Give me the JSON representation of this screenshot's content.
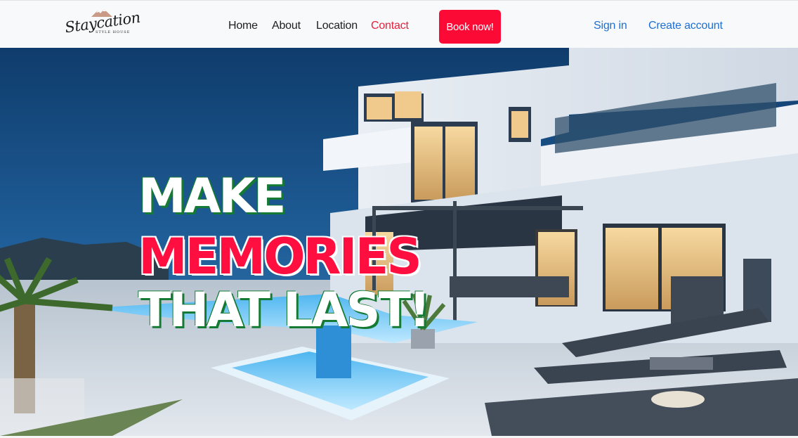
{
  "logo": {
    "script_text": "Staycation",
    "subtitle": "STYLE HOUSE"
  },
  "nav": {
    "home": "Home",
    "about": "About",
    "location": "Location",
    "contact": "Contact",
    "book_now": "Book now!",
    "sign_in": "Sign in",
    "create_account": "Create account"
  },
  "hero": {
    "line1": "MAKE",
    "line2": "MEMORIES",
    "line3": "THAT LAST!"
  },
  "colors": {
    "accent_red": "#fb0a36",
    "link_blue": "#1e6fd0",
    "headline_green_shadow": "#157a34"
  },
  "icons": [
    "mountain-logo-icon"
  ]
}
